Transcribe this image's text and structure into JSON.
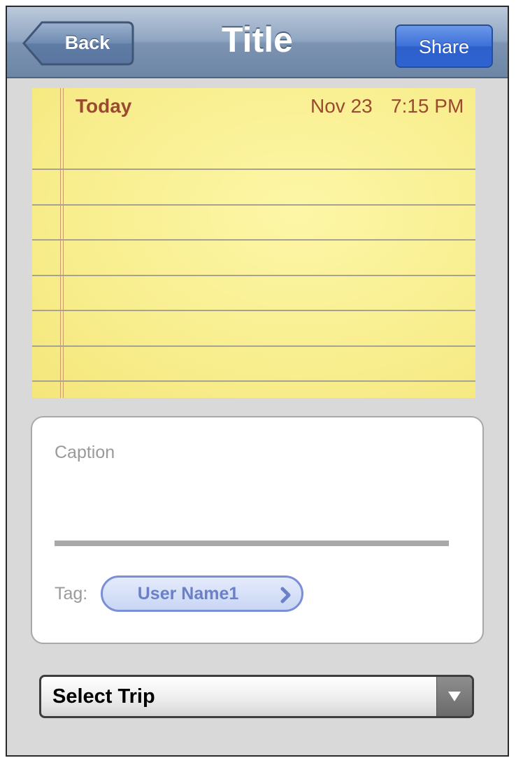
{
  "navbar": {
    "title": "Title",
    "back_label": "Back",
    "share_label": "Share",
    "colors": {
      "bar": "#8fa5c1",
      "share_button": "#3d70d8"
    }
  },
  "note": {
    "day_label": "Today",
    "date": "Nov 23",
    "time": "7:15 PM",
    "paper_color": "#f8ee8e",
    "text_color": "#9a4a2e"
  },
  "caption_card": {
    "caption_placeholder": "Caption",
    "tag_label": "Tag:",
    "tag_value": "User Name1",
    "tag_icon": "chevron-right-icon"
  },
  "trip_select": {
    "selected": "Select Trip",
    "icon": "dropdown-arrow-icon"
  }
}
